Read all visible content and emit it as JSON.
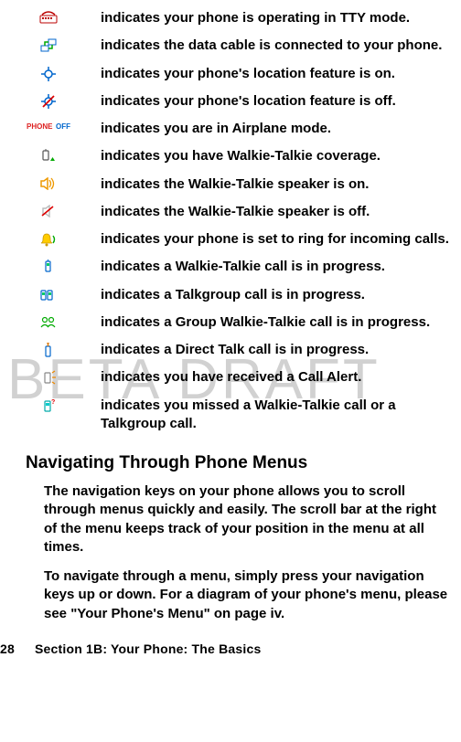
{
  "watermark": "BETA DRAFT",
  "icons": [
    {
      "name": "tty-icon",
      "desc": "indicates your phone is operating in TTY mode."
    },
    {
      "name": "data-cable-icon",
      "desc": "indicates the data cable is connected to your phone."
    },
    {
      "name": "location-on-icon",
      "desc": "indicates your phone's location feature is on."
    },
    {
      "name": "location-off-icon",
      "desc": "indicates your phone's location feature is off."
    },
    {
      "name": "airplane-mode-icon",
      "desc": "indicates you are in Airplane mode."
    },
    {
      "name": "wt-coverage-icon",
      "desc": "indicates you have Walkie-Talkie coverage."
    },
    {
      "name": "wt-speaker-on-icon",
      "desc": "indicates the Walkie-Talkie speaker is on."
    },
    {
      "name": "wt-speaker-off-icon",
      "desc": "indicates the Walkie-Talkie speaker is off."
    },
    {
      "name": "ring-incoming-icon",
      "desc": "indicates your phone is set to ring for incoming calls."
    },
    {
      "name": "wt-call-progress-icon",
      "desc": "indicates a Walkie-Talkie call is in progress."
    },
    {
      "name": "talkgroup-call-icon",
      "desc": "indicates a Talkgroup call is in progress."
    },
    {
      "name": "group-wt-call-icon",
      "desc": "indicates a Group Walkie-Talkie call is in progress."
    },
    {
      "name": "direct-talk-icon",
      "desc": "indicates a Direct Talk call is in progress."
    },
    {
      "name": "call-alert-icon",
      "desc": "indicates you have received a Call Alert."
    },
    {
      "name": "missed-wt-call-icon",
      "desc": "indicates you missed a Walkie-Talkie call or a Talkgroup call."
    }
  ],
  "heading": "Navigating Through Phone Menus",
  "para1": "The navigation keys on your phone allows you to scroll through menus quickly and easily. The scroll bar at the right of the menu keeps track of your position in the menu at all times.",
  "para2": "To navigate through a menu, simply press your navigation keys up or down. For a diagram of your phone's menu, please see \"Your Phone's Menu\" on page iv.",
  "footer": {
    "page": "28",
    "title": "Section 1B: Your Phone: The Basics"
  }
}
